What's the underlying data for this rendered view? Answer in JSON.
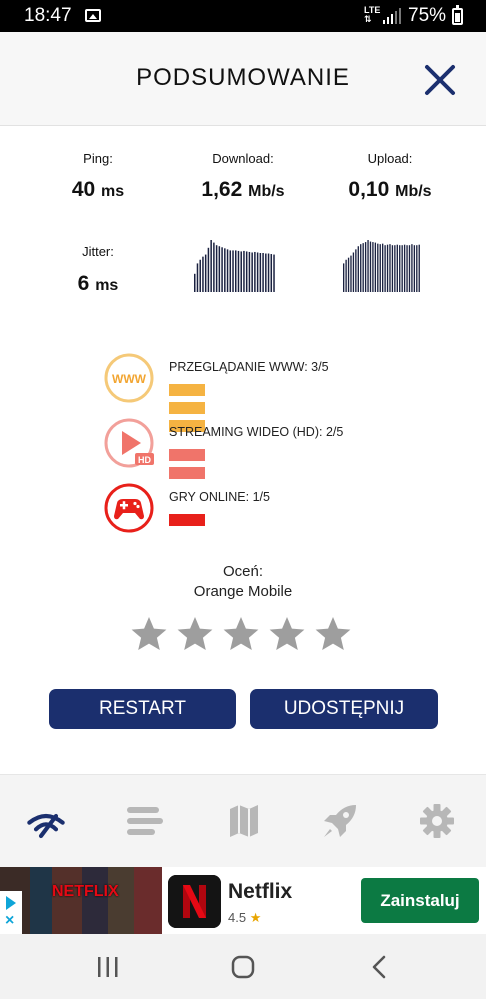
{
  "status_bar": {
    "time": "18:47",
    "network": "LTE",
    "battery": "75%"
  },
  "header": {
    "title": "PODSUMOWANIE"
  },
  "metrics": {
    "ping": {
      "label": "Ping:",
      "value": "40",
      "unit": "ms"
    },
    "download": {
      "label": "Download:",
      "value": "1,62",
      "unit": "Mb/s"
    },
    "upload": {
      "label": "Upload:",
      "value": "0,10",
      "unit": "Mb/s"
    },
    "jitter": {
      "label": "Jitter:",
      "value": "6",
      "unit": "ms"
    }
  },
  "graphs": {
    "download": [
      0.35,
      0.55,
      0.62,
      0.68,
      0.72,
      0.85,
      1.0,
      0.95,
      0.9,
      0.88,
      0.86,
      0.84,
      0.82,
      0.8,
      0.8,
      0.8,
      0.79,
      0.78,
      0.79,
      0.78,
      0.77,
      0.76,
      0.77,
      0.76,
      0.75,
      0.75,
      0.74,
      0.74,
      0.73,
      0.72
    ],
    "upload": [
      0.55,
      0.62,
      0.66,
      0.7,
      0.76,
      0.82,
      0.88,
      0.92,
      0.94,
      0.96,
      1.0,
      0.97,
      0.96,
      0.95,
      0.93,
      0.92,
      0.93,
      0.9,
      0.91,
      0.92,
      0.9,
      0.9,
      0.91,
      0.9,
      0.9,
      0.91,
      0.9,
      0.9,
      0.92,
      0.9,
      0.9,
      0.91
    ]
  },
  "ratings": [
    {
      "label": "PRZEGLĄDANIE WWW: 3/5",
      "icon": "www-icon",
      "icon_text": "WWW",
      "score": 3,
      "color": "#f5b342"
    },
    {
      "label": "STREAMING WIDEO (HD): 2/5",
      "icon": "video-play-icon",
      "icon_text": "HD",
      "score": 2,
      "color": "#f0746a"
    },
    {
      "label": "GRY ONLINE: 1/5",
      "icon": "gamepad-icon",
      "score": 1,
      "color": "#e8201a"
    }
  ],
  "rate": {
    "label": "Oceń:",
    "operator": "Orange Mobile",
    "stars": 5,
    "star_color": "#9e9e9e"
  },
  "buttons": {
    "restart": "RESTART",
    "share": "UDOSTĘPNIJ"
  },
  "colors": {
    "primary": "#1b2f6e",
    "nav_active": "#1b2f6e",
    "nav_inactive": "#b7b7b7",
    "install": "#0c7a43"
  },
  "bottom_nav": [
    {
      "icon": "speed-test-icon",
      "active": true
    },
    {
      "icon": "results-list-icon",
      "active": false
    },
    {
      "icon": "map-icon",
      "active": false
    },
    {
      "icon": "rocket-icon",
      "active": false
    },
    {
      "icon": "settings-icon",
      "active": false
    }
  ],
  "ad": {
    "image_text": "NETFLIX",
    "app_name": "Netflix",
    "rating": "4.5",
    "install_label": "Zainstaluj"
  }
}
